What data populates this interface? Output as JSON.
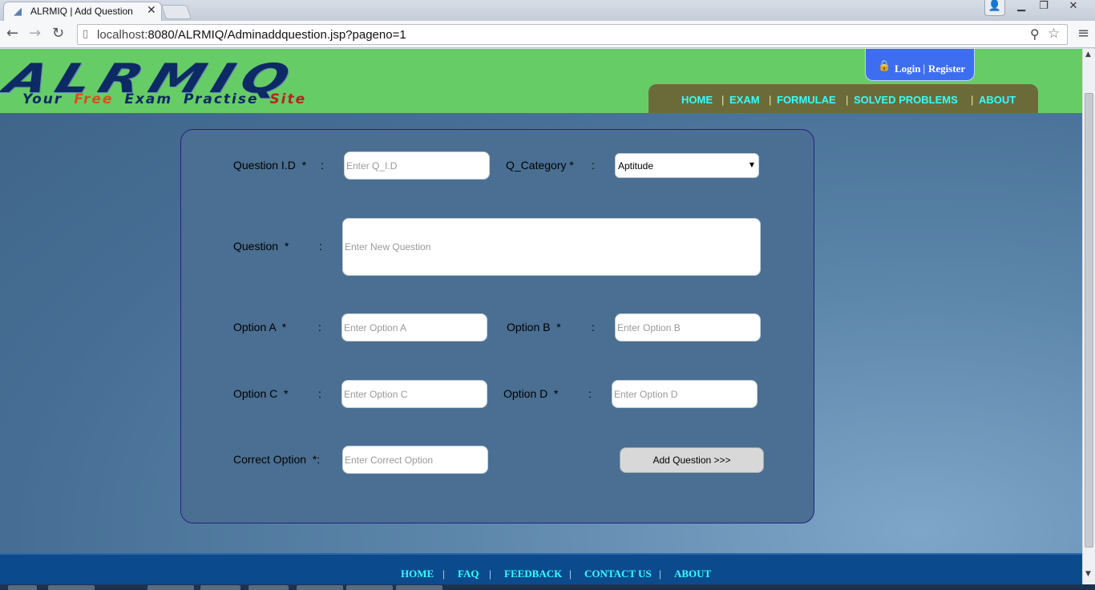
{
  "browser": {
    "tab_title": "ALRMIQ | Add Question",
    "tab_close": "✕",
    "url_host": "localhost:",
    "url_rest": "8080/ALRMIQ/Adminaddquestion.jsp?pageno=1",
    "icons": [
      "back-icon",
      "forward-icon",
      "reload-icon",
      "page-icon",
      "zoom-icon",
      "star-icon",
      "menu-icon",
      "user-icon",
      "minimize-icon",
      "maximize-icon",
      "close-icon"
    ]
  },
  "header": {
    "logo_title": "ALRMIQ",
    "tagline": [
      "Your",
      "Free",
      "Exam",
      "Practise",
      "Site"
    ],
    "login": "Login",
    "separator": "|",
    "register": "Register",
    "nav": [
      "HOME",
      "EXAM",
      "FORMULAE",
      "SOLVED PROBLEMS",
      "ABOUT"
    ]
  },
  "form": {
    "qid_label": "Question I.D  *",
    "qid_placeholder": "Enter Q_I.D",
    "category_label": "Q_Category *",
    "category_value": "Aptitude",
    "question_label": "Question  *",
    "question_placeholder": "Enter New Question",
    "optA_label": "Option A  *",
    "optA_placeholder": "Enter Option A",
    "optB_label": "Option B  *",
    "optB_placeholder": "Enter Option B",
    "optC_label": "Option C  *",
    "optC_placeholder": "Enter Option C",
    "optD_label": "Option D  *",
    "optD_placeholder": "Enter Option D",
    "correct_label": "Correct Option  *:",
    "correct_placeholder": "Enter Correct Option",
    "colon": ":",
    "submit_label": "Add Question   >>>"
  },
  "footer": {
    "links": [
      "HOME",
      "FAQ",
      "FEEDBACK",
      "CONTACT US",
      "ABOUT"
    ],
    "separator": "|"
  },
  "colors": {
    "header_bg": "#66cc66",
    "nav_bg": "#6b6b3a",
    "nav_text": "#33ffff",
    "card_bg": "#4a6f92",
    "footer_bg": "#0b4b8d"
  }
}
